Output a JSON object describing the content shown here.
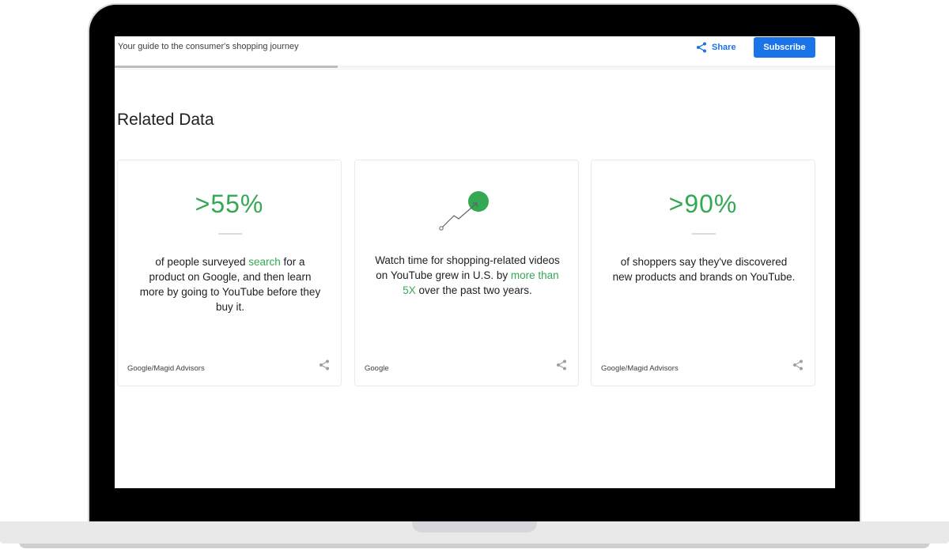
{
  "header": {
    "title": "Your guide to the consumer's shopping journey",
    "share_label": "Share",
    "subscribe_label": "Subscribe",
    "reading_progress": 0.31
  },
  "section": {
    "title": "Related Data"
  },
  "cards": [
    {
      "stat": ">55%",
      "text_before": "of people surveyed ",
      "highlight": "search",
      "text_after": " for a product on Google, and then learn more by going to YouTube before they buy it.",
      "source": "Google/Magid Advisors"
    },
    {
      "icon": "trend-up-icon",
      "text_before": "Watch time for shopping-related videos on YouTube grew in U.S. by ",
      "highlight": "more than 5X",
      "text_after": " over the past two years.",
      "source": "Google"
    },
    {
      "stat": ">90%",
      "text": "of shoppers say they've discovered new products and brands on YouTube.",
      "source": "Google/Magid Advisors"
    }
  ],
  "colors": {
    "accent_blue": "#1a73e8",
    "accent_green": "#34a853",
    "text_dark": "#202124",
    "frame": "#000000"
  },
  "icons": {
    "share": "share-icon",
    "card_share": "share-icon",
    "trend": "trend-up-icon"
  }
}
